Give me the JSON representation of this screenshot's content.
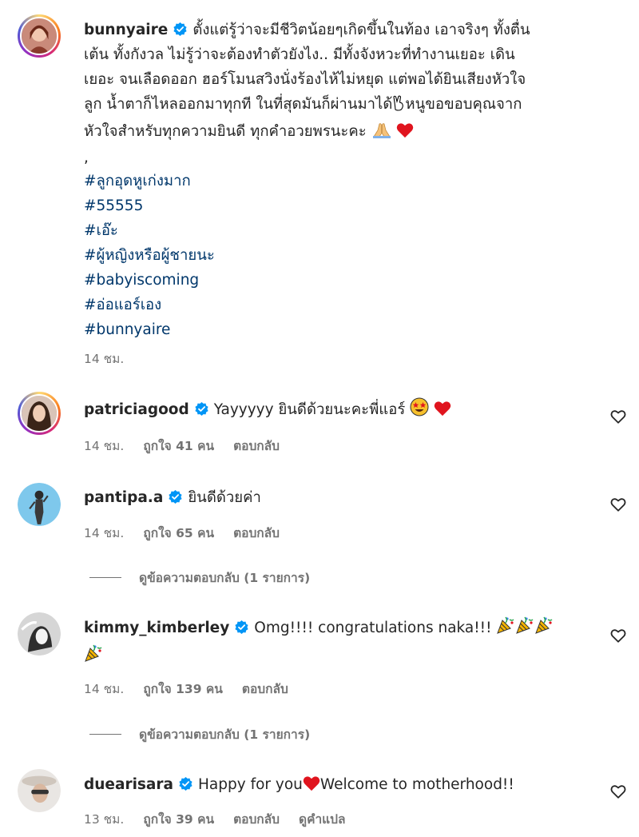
{
  "post": {
    "username": "bunnyaire",
    "caption_lines": [
      "ตั้งแต่รู้ว่าจะมีชีวิตน้อยๆเกิดขึ้นในท้อง เอาจริงๆ ทั้งตื่น",
      "เต้น ทั้งกังวล ไม่รู้ว่าจะต้องทำตัวยังไง.. มีทั้งจังหวะที่ทำงานเยอะ เดิน",
      "เยอะ จนเลือดออก ฮอร์โมนสวิงนั่งร้องไห้ไม่หยุด แต่พอได้ยินเสียงหัวใจ",
      "ลูก น้ำตาก็ไหลออกมาทุกที ในที่สุดมันก็ผ่านมาได้",
      "หนูขอขอบคุณจาก",
      "หัวใจสำหรับทุกความยินดี ทุกคำอวยพรนะคะ"
    ],
    "separator": ",",
    "hashtags": [
      "#ลูกอุดหูเก่งมาก",
      "#55555",
      "#เอ๊ะ",
      "#ผู้หญิงหรือผู้ชายนะ",
      "#babyiscoming",
      "#อ่อแอร์เอง",
      "#bunnyaire"
    ],
    "time": "14 ชม."
  },
  "comments": [
    {
      "username": "patriciagood",
      "text": "Yayyyyy ยินดีด้วยนะคะพี่แอร์",
      "time": "14 ชม.",
      "likes": "ถูกใจ 41 คน",
      "reply": "ตอบกลับ"
    },
    {
      "username": "pantipa.a",
      "text": "ยินดีด้วยค่า",
      "time": "14 ชม.",
      "likes": "ถูกใจ 65 คน",
      "reply": "ตอบกลับ",
      "view_replies": "ดูข้อความตอบกลับ (1 รายการ)"
    },
    {
      "username": "kimmy_kimberley",
      "text": "Omg!!!! congratulations naka!!!",
      "time": "14 ชม.",
      "likes": "ถูกใจ 139 คน",
      "reply": "ตอบกลับ",
      "view_replies": "ดูข้อความตอบกลับ (1 รายการ)"
    },
    {
      "username": "duearisara",
      "text_before": "Happy for you",
      "text_after": "Welcome to motherhood!!",
      "time": "13 ชม.",
      "likes": "ถูกใจ 39 คน",
      "reply": "ตอบกลับ",
      "translate": "ดูคำแปล"
    }
  ],
  "colors": {
    "hashtag": "#00376b",
    "verified": "#0095f6",
    "meta": "#737373",
    "heart": "#ed1c3a"
  }
}
